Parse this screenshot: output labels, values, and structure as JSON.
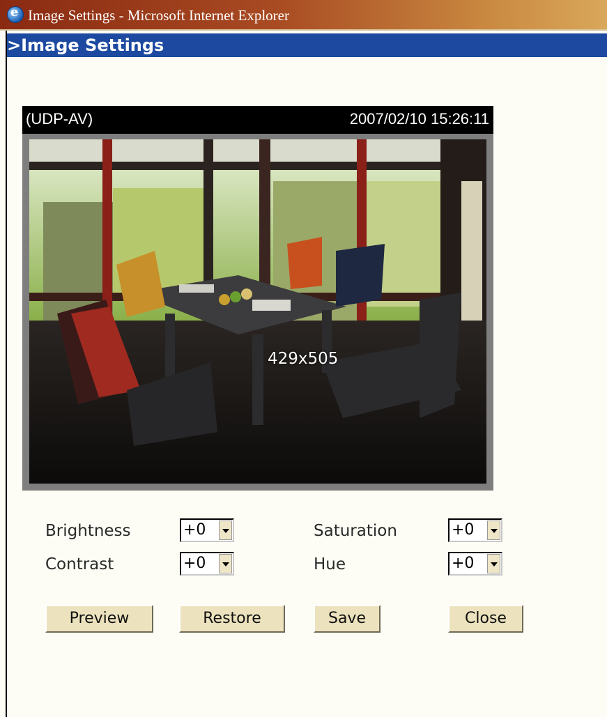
{
  "window": {
    "title": "Image Settings - Microsoft Internet Explorer"
  },
  "page": {
    "heading": ">Image Settings"
  },
  "camera": {
    "mode": "(UDP-AV)",
    "timestamp": "2007/02/10 15:26:11",
    "resolution": "429x505"
  },
  "settings": {
    "brightness": {
      "label": "Brightness",
      "value": "+0"
    },
    "contrast": {
      "label": "Contrast",
      "value": "+0"
    },
    "saturation": {
      "label": "Saturation",
      "value": "+0"
    },
    "hue": {
      "label": "Hue",
      "value": "+0"
    }
  },
  "buttons": {
    "preview": "Preview",
    "restore": "Restore",
    "save": "Save",
    "close": "Close"
  }
}
